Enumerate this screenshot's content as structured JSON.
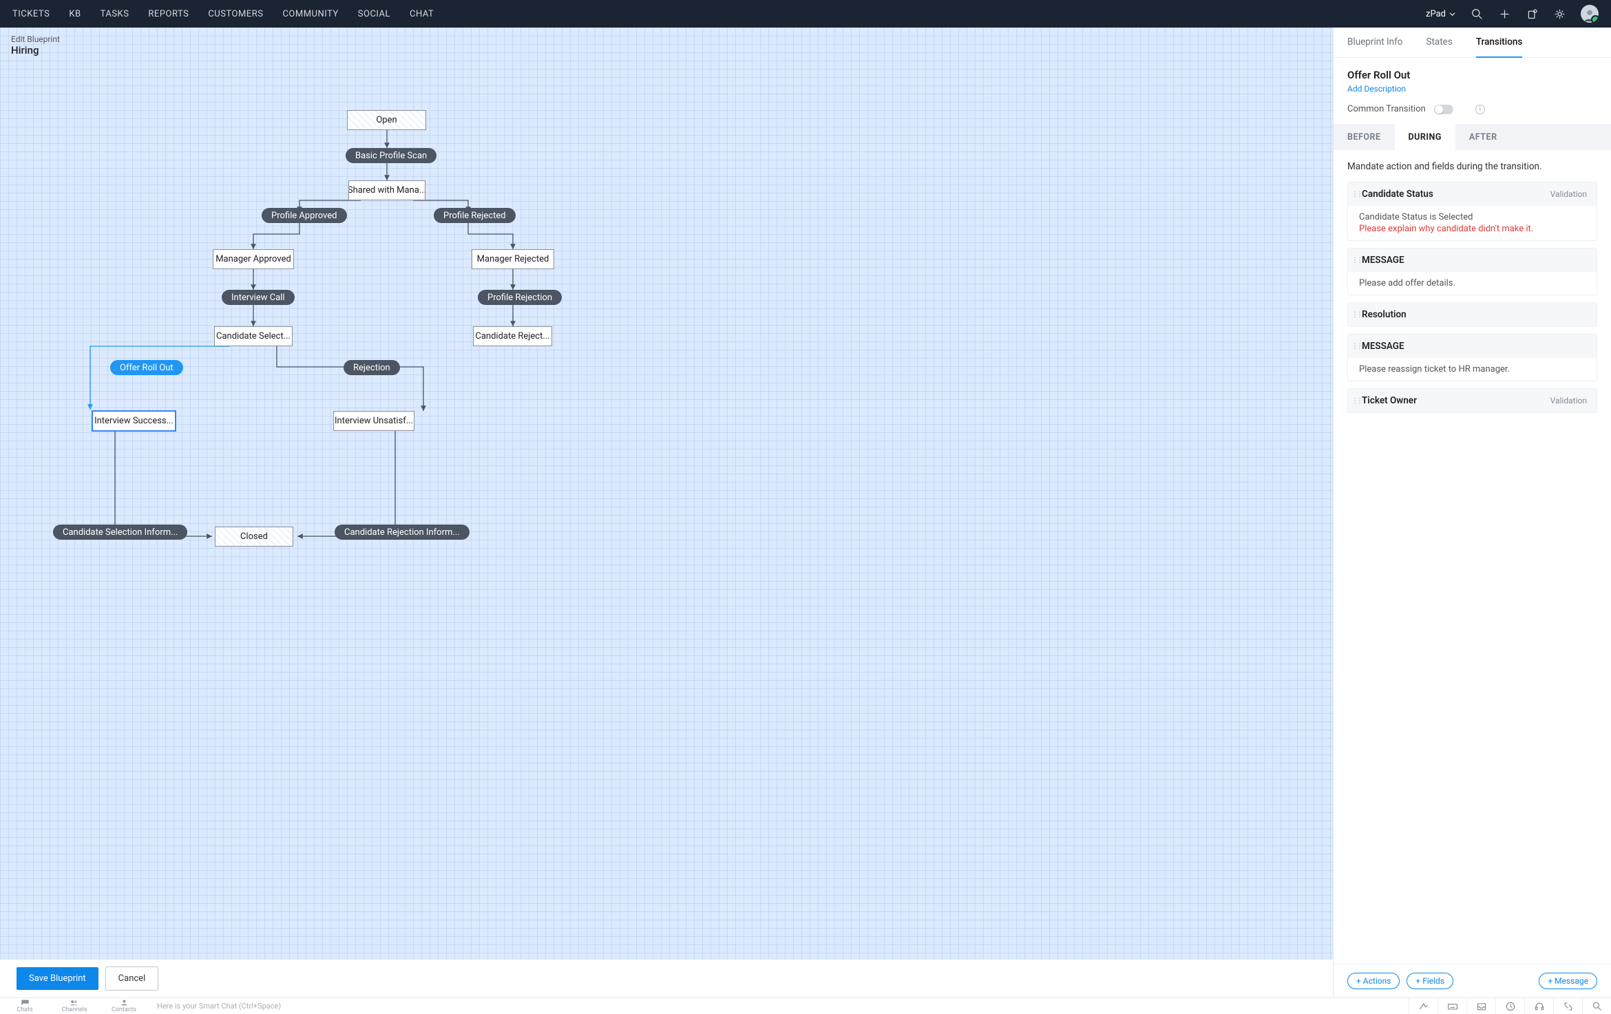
{
  "topnav": {
    "items": [
      "TICKETS",
      "KB",
      "TASKS",
      "REPORTS",
      "CUSTOMERS",
      "COMMUNITY",
      "SOCIAL",
      "CHAT"
    ],
    "workspace": "zPad"
  },
  "canvas": {
    "crumb": "Edit Blueprint",
    "title": "Hiring",
    "states": {
      "open": "Open",
      "shared": "Shared with Mana...",
      "mgr_appr": "Manager Approved",
      "mgr_rej": "Manager Rejected",
      "cand_sel": "Candidate Select...",
      "cand_rej": "Candidate Reject...",
      "int_succ": "Interview Success...",
      "int_unsat": "Interview Unsatisf...",
      "closed": "Closed"
    },
    "transitions": {
      "bps": "Basic Profile Scan",
      "p_appr": "Profile Approved",
      "p_rej": "Profile Rejected",
      "int_call": "Interview Call",
      "prof_rej": "Profile Rejection",
      "offer": "Offer Roll Out",
      "rejection": "Rejection",
      "csi": "Candidate Selection Inform...",
      "cri": "Candidate Rejection Inform..."
    },
    "save": "Save Blueprint",
    "cancel": "Cancel"
  },
  "panel": {
    "tabs": {
      "info": "Blueprint Info",
      "states": "States",
      "transitions": "Transitions"
    },
    "title": "Offer Roll Out",
    "add_desc": "Add Description",
    "common": "Common Transition",
    "bda": {
      "before": "BEFORE",
      "during": "DURING",
      "after": "AFTER"
    },
    "mandate": "Mandate action and fields during the transition.",
    "cards": [
      {
        "title": "Candidate Status",
        "tag": "Validation",
        "line": "Candidate Status is  Selected",
        "err": "Please explain why candidate didn't make it."
      },
      {
        "title": "MESSAGE",
        "line": "Please add offer details."
      },
      {
        "title": "Resolution"
      },
      {
        "title": "MESSAGE",
        "line": "Please reassign ticket to HR manager."
      },
      {
        "title": "Ticket Owner",
        "tag": "Validation"
      }
    ],
    "footer": {
      "actions": "+ Actions",
      "fields": "+ Fields",
      "message": "+ Message"
    }
  },
  "bottombar": {
    "items": [
      "Chats",
      "Channels",
      "Contacts"
    ],
    "placeholder": "Here is your Smart Chat (Ctrl+Space)"
  }
}
